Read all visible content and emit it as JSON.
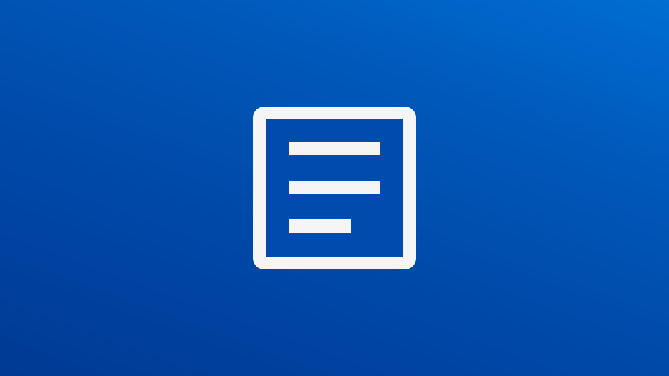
{
  "splash": {
    "icon": "document-lines-icon",
    "background_colors": [
      "#003a94",
      "#0049a9",
      "#0058b9",
      "#006ed2"
    ],
    "icon_color": "#f5f5f5"
  }
}
